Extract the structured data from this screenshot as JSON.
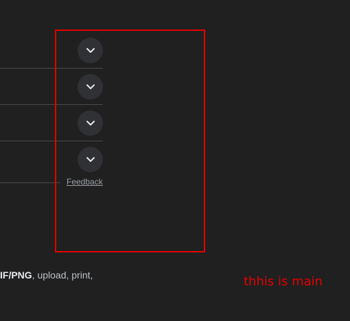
{
  "accordion": {
    "items": [
      {
        "expand_icon": "chevron-down-icon"
      },
      {
        "expand_icon": "chevron-down-icon"
      },
      {
        "expand_icon": "chevron-down-icon"
      },
      {
        "expand_icon": "chevron-down-icon"
      }
    ],
    "feedback_label": "Feedback"
  },
  "snippet": {
    "bold_text": "IF/PNG",
    "rest_text": ", upload, print,"
  },
  "annotation": {
    "label": "thhis is main",
    "color": "#e60000"
  },
  "colors": {
    "background": "#202020",
    "button_bg": "#303134",
    "divider": "#4a4a4a",
    "link": "#9aa0a6"
  }
}
